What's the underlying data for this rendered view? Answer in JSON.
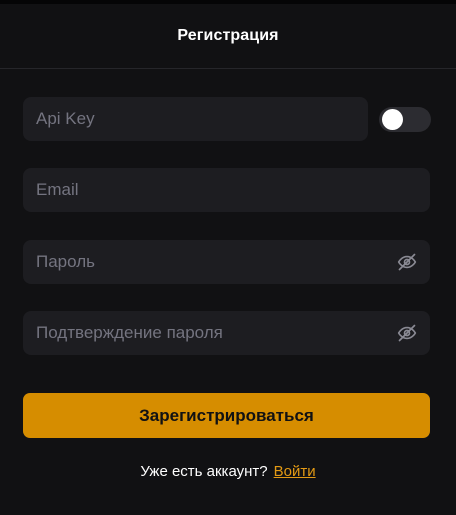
{
  "header": {
    "title": "Регистрация"
  },
  "form": {
    "api_key": {
      "placeholder": "Api Key",
      "toggle_on": false
    },
    "email": {
      "placeholder": "Email"
    },
    "password": {
      "placeholder": "Пароль",
      "icon": "eye-off-icon"
    },
    "confirm_password": {
      "placeholder": "Подтверждение пароля",
      "icon": "eye-off-icon"
    },
    "submit_label": "Зарегистрироваться"
  },
  "footer": {
    "question": "Уже есть аккаунт?",
    "login_link": "Войти"
  },
  "colors": {
    "background": "#111113",
    "field": "#1d1d21",
    "accent": "#d68d00",
    "link": "#e39a14"
  }
}
